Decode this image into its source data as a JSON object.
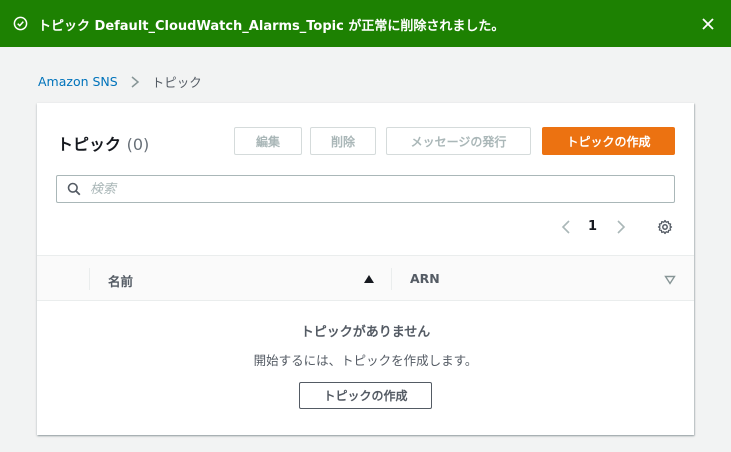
{
  "flash": {
    "message": "トピック Default_CloudWatch_Alarms_Topic が正常に削除されました。",
    "status_icon": "check-circle-icon",
    "close_icon": "close-icon"
  },
  "breadcrumb": {
    "root": "Amazon SNS",
    "current": "トピック"
  },
  "panel": {
    "title": "トピック",
    "count": "(0)",
    "buttons": {
      "edit": "編集",
      "delete": "削除",
      "publish": "メッセージの発行",
      "create": "トピックの作成"
    },
    "search": {
      "placeholder": "検索",
      "value": ""
    },
    "pagination": {
      "page": "1"
    },
    "table": {
      "columns": [
        "名前",
        "ARN"
      ],
      "rows": []
    },
    "empty": {
      "title": "トピックがありません",
      "description": "開始するには、トピックを作成します。",
      "button": "トピックの作成"
    }
  },
  "colors": {
    "success": "#1d8102",
    "primary": "#ec7211",
    "link": "#0073bb"
  }
}
